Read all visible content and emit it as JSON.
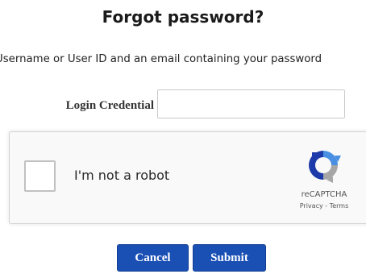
{
  "page": {
    "title": "Forgot password?",
    "instructions": "Username or User ID and an email containing your password"
  },
  "form": {
    "credential_label": "Login Credential",
    "credential_value": ""
  },
  "captcha": {
    "checkbox_label": "I'm not a robot",
    "brand": "reCAPTCHA",
    "privacy_link": "Privacy",
    "separator": " - ",
    "terms_link": "Terms",
    "logo_icon": "recaptcha-logo-icon",
    "colors": {
      "logo_blue": "#4a90e2",
      "logo_dark_blue": "#1c3aa9",
      "logo_gray": "#a6a6a6"
    }
  },
  "buttons": {
    "cancel_label": "Cancel",
    "submit_label": "Submit",
    "color": "#1a4fb4"
  }
}
